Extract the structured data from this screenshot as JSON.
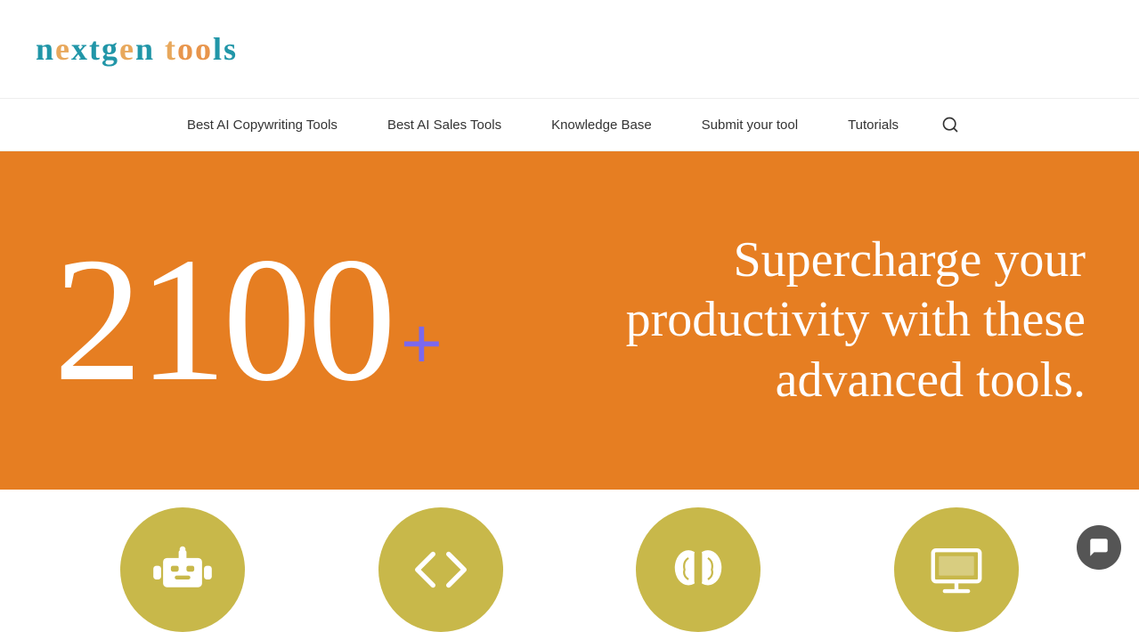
{
  "logo": {
    "text": "nextgen tools",
    "letters": [
      "n",
      "e",
      "x",
      "t",
      "g",
      "e",
      "n",
      " ",
      "t",
      "o",
      "o",
      "l",
      "s"
    ]
  },
  "nav": {
    "items": [
      {
        "label": "Best AI Copywriting Tools",
        "id": "nav-copywriting"
      },
      {
        "label": "Best AI Sales Tools",
        "id": "nav-sales"
      },
      {
        "label": "Knowledge Base",
        "id": "nav-knowledge"
      },
      {
        "label": "Submit your tool",
        "id": "nav-submit"
      },
      {
        "label": "Tutorials",
        "id": "nav-tutorials"
      }
    ],
    "search_label": "🔍"
  },
  "hero": {
    "number": "2100",
    "plus": "+",
    "tagline": "Supercharge your productivity with these advanced tools."
  },
  "icons": [
    {
      "id": "robot",
      "label": "AI Robot"
    },
    {
      "id": "code",
      "label": "Code"
    },
    {
      "id": "brain",
      "label": "Brain"
    },
    {
      "id": "monitor",
      "label": "Monitor"
    }
  ],
  "chat": {
    "label": "Chat"
  }
}
